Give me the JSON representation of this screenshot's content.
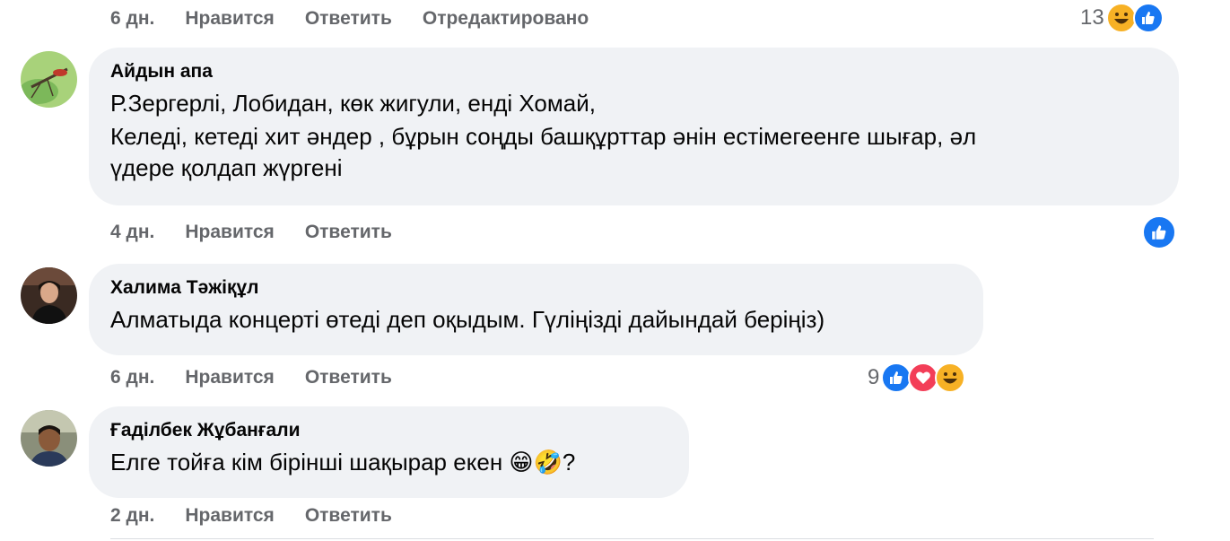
{
  "top_meta": {
    "time": "6 дн.",
    "like": "Нравится",
    "reply": "Ответить",
    "edited": "Отредактировано",
    "reaction_count": "13"
  },
  "comments": [
    {
      "author": "Айдын апа",
      "lines": [
        "Р.Зергерлі, Лобидан, көк жигули, енді Хомай,",
        "Келеді, кетеді хит әндер , бұрын соңды башқұрттар әнін естімегеенге шығар, әл",
        "үдере қолдап жүргені"
      ],
      "time": "4 дн.",
      "like": "Нравится",
      "reply": "Ответить",
      "reaction_count": ""
    },
    {
      "author": "Халима Тәжіқұл",
      "lines": [
        "Алматыда концерті өтеді деп оқыдым. Гүліңізді дайындай беріңіз)"
      ],
      "time": "6 дн.",
      "like": "Нравится",
      "reply": "Ответить",
      "reaction_count": "9"
    },
    {
      "author": "Ғаділбек Жұбанғали",
      "lines": [
        "Елге тойға кім бірінші шақырар екен 😁🤣?"
      ],
      "time": "2 дн.",
      "like": "Нравится",
      "reply": "Ответить",
      "reaction_count": ""
    }
  ],
  "icons": {
    "like": "like-icon",
    "love": "love-icon",
    "haha": "haha-icon"
  },
  "colors": {
    "like": "#1877f2",
    "love": "#f33e58",
    "haha": "#f7b125",
    "bubble": "#f0f2f5",
    "meta": "#65676b"
  }
}
